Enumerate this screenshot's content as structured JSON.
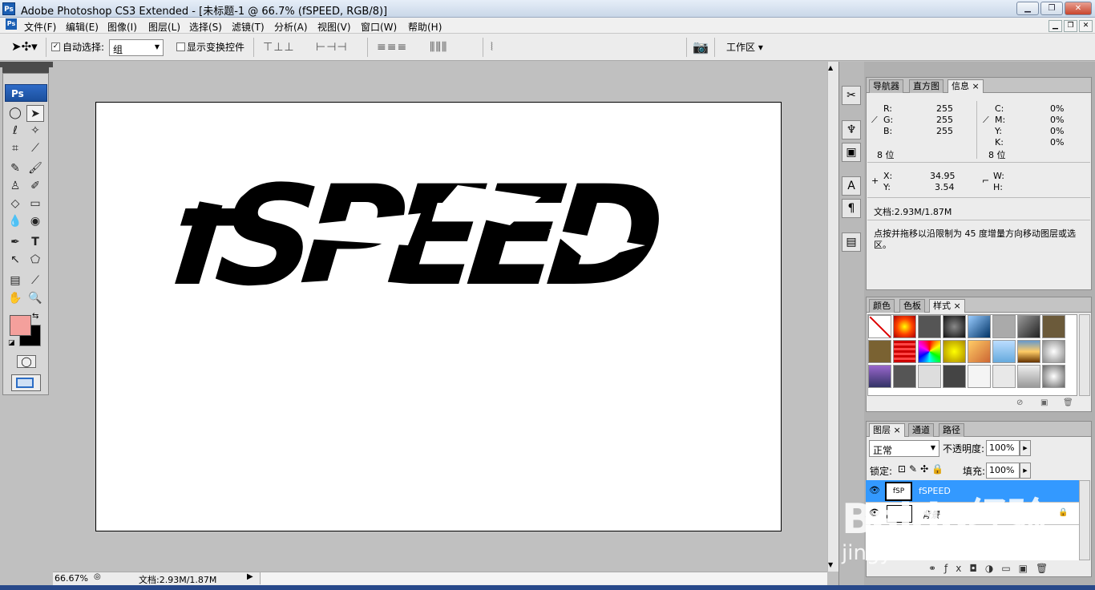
{
  "window": {
    "title": "Adobe Photoshop CS3 Extended - [未标题-1 @ 66.7% (fSPEED, RGB/8)]",
    "app_badge": "Ps"
  },
  "menu": [
    "文件(F)",
    "编辑(E)",
    "图像(I)",
    "图层(L)",
    "选择(S)",
    "滤镜(T)",
    "分析(A)",
    "视图(V)",
    "窗口(W)",
    "帮助(H)"
  ],
  "options": {
    "auto_select_label": "自动选择:",
    "auto_select_value": "组",
    "show_transform_label": "显示变换控件",
    "workspace_label": "工作区 ▾"
  },
  "toolbox": {
    "logo": "Ps"
  },
  "colors": {
    "foreground": "#f4a09c",
    "background": "#000000",
    "selected_layer": "#3399ff"
  },
  "canvas": {
    "text": "fSPEED"
  },
  "status": {
    "zoom": "66.67%",
    "doc": "文档:2.93M/1.87M"
  },
  "info_panel": {
    "tabs": [
      "导航器",
      "直方图",
      "信息"
    ],
    "rgb": [
      {
        "k": "R:",
        "v": "255"
      },
      {
        "k": "G:",
        "v": "255"
      },
      {
        "k": "B:",
        "v": "255"
      }
    ],
    "cmyk": [
      {
        "k": "C:",
        "v": "0%"
      },
      {
        "k": "M:",
        "v": "0%"
      },
      {
        "k": "Y:",
        "v": "0%"
      },
      {
        "k": "K:",
        "v": "0%"
      }
    ],
    "bits_left": "8 位",
    "bits_right": "8 位",
    "x_label": "X:",
    "x_value": "34.95",
    "y_label": "Y:",
    "y_value": "3.54",
    "w_label": "W:",
    "h_label": "H:",
    "doc": "文档:2.93M/1.87M",
    "hint": "点按并拖移以沿限制为 45 度增量方向移动图层或选区。"
  },
  "styles_panel": {
    "tabs": [
      "颜色",
      "色板",
      "样式"
    ]
  },
  "layers_panel": {
    "tabs": [
      "图层",
      "通道",
      "路径"
    ],
    "blend_mode": "正常",
    "opacity_label": "不透明度:",
    "opacity": "100%",
    "lock_label": "锁定:",
    "fill_label": "填充:",
    "fill": "100%",
    "layers": [
      {
        "name": "fSPEED",
        "selected": true
      },
      {
        "name": "背景",
        "selected": false
      }
    ]
  },
  "watermark": {
    "brand": "Baidu经验",
    "url": "jingyan.baidu.com"
  }
}
